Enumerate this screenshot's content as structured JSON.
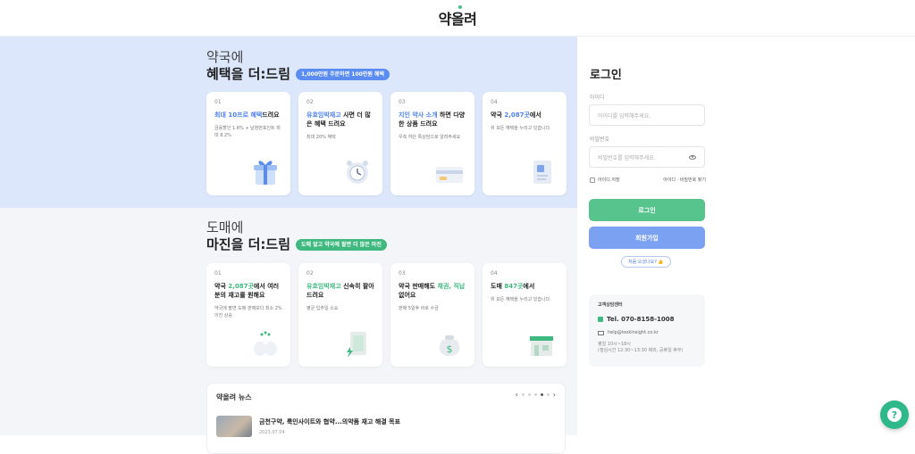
{
  "header": {
    "logo": "약올려"
  },
  "pharmacy": {
    "title_line1": "약국에",
    "title_line2": "혜택을 더:드림",
    "pill": "1,000만원 주문하면 100만원 혜택",
    "cards": [
      {
        "num": "01",
        "hl": "최대 10프로 혜택",
        "rest": "드려요",
        "desc": "금융할인 1.8% + 날염번포인트 최대 8.2%"
      },
      {
        "num": "02",
        "hl": "유효임박재고",
        "rest": " 사면 더 많은 혜택 드려요",
        "desc": "최대 20% 혜택"
      },
      {
        "num": "03",
        "hl": "지인 약사 소개",
        "rest": " 하면 다양한 상품 드려요",
        "desc": "우측 하단 톡상담으로 알려주세요"
      },
      {
        "num": "04",
        "pre": "약국 ",
        "hl": "2,087곳",
        "rest": "에서",
        "desc": "위 모든 혜택을 누리고 있습니다."
      }
    ]
  },
  "wholesale": {
    "title_line1": "도매에",
    "title_line2": "마진을 더:드림",
    "pill": "도매 알고 약국에 팔면 더 많은 마진",
    "cards": [
      {
        "num": "01",
        "pre": "약국 ",
        "hl": "2,087곳",
        "rest": "에서 여러분의 재고를 원해요",
        "desc": "약국에 팔면 도매 판매보다 최소 2% 이진 상승"
      },
      {
        "num": "02",
        "hl": "유효임박재고",
        "rest": " 신속히 팔아드려요",
        "desc": "평균 입주일 소요"
      },
      {
        "num": "03",
        "pre": "약국 판매해도 ",
        "hl": "채권, 직납",
        "rest": " 없어요",
        "desc": "판매 5일후 바로 수금"
      },
      {
        "num": "04",
        "pre": "도매 ",
        "hl": "847곳",
        "rest": "에서",
        "desc": "위 모든 혜택을 누리고 있습니다."
      }
    ]
  },
  "news": {
    "heading": "약올려 뉴스",
    "item_title": "금천구약, 룩인사이트와 협약...의약품 재고 해결 목표",
    "item_date": "2023.07.04"
  },
  "login": {
    "title": "로그인",
    "id_label": "아이디",
    "id_placeholder": "아이디를 입력해주세요.",
    "pw_label": "비밀번호",
    "pw_placeholder": "비밀번호를 입력해주세요.",
    "remember": "아이디 저장",
    "find": "아이디 · 비밀번호 찾기",
    "login_btn": "로그인",
    "signup_btn": "회원가입",
    "first_visit": "처음 오셨나요? 👍"
  },
  "support": {
    "heading": "고객상담센터",
    "tel": "Tel. 070-8158-1008",
    "email": "help@lookinsight.co.kr",
    "hours1": "평일 10시~18시",
    "hours2": "(점심시간 12:30~13:30 제외, 공휴일 휴무)"
  },
  "colors": {
    "accent_blue": "#4d82ee",
    "accent_green": "#3fb97f",
    "band": "#dce7fb"
  }
}
